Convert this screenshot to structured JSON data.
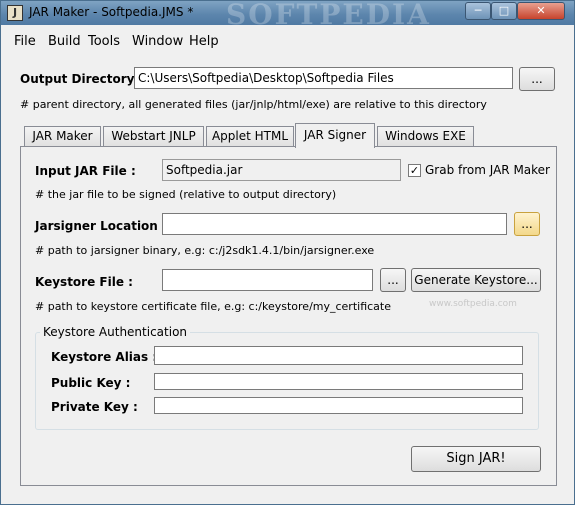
{
  "window": {
    "title": "JAR Maker - Softpedia.JMS *",
    "watermark": "SOFTPEDIA",
    "controls": {
      "minimize": "─",
      "maximize": "□",
      "close": "✕"
    }
  },
  "menu": [
    {
      "label": "File"
    },
    {
      "label": "Build"
    },
    {
      "label": "Tools"
    },
    {
      "label": "Window"
    },
    {
      "label": "Help"
    }
  ],
  "output": {
    "label": "Output Directory :",
    "value": "C:\\Users\\Softpedia\\Desktop\\Softpedia Files",
    "browse": "...",
    "hint": "# parent directory, all generated files (jar/jnlp/html/exe) are relative to this directory"
  },
  "tabs": [
    {
      "label": "JAR Maker"
    },
    {
      "label": "Webstart JNLP"
    },
    {
      "label": "Applet HTML"
    },
    {
      "label": "JAR Signer"
    },
    {
      "label": "Windows EXE"
    }
  ],
  "signer": {
    "input_jar": {
      "label": "Input JAR File :",
      "value": "Softpedia.jar",
      "checkbox_label": "Grab from JAR Maker",
      "checked": "✓",
      "hint": "# the jar file to be signed (relative to output directory)"
    },
    "jarsigner": {
      "label": "Jarsigner Location :",
      "value": "",
      "browse": "...",
      "hint": "# path to jarsigner binary, e.g: c:/j2sdk1.4.1/bin/jarsigner.exe"
    },
    "keystore": {
      "label": "Keystore File :",
      "value": "",
      "browse": "...",
      "generate": "Generate Keystore...",
      "hint": "# path to keystore certificate file, e.g: c:/keystore/my_certificate"
    },
    "auth": {
      "title": "Keystore Authentication",
      "alias_label": "Keystore Alias :",
      "public_key_label": "Public Key :",
      "private_key_label": "Private Key :"
    },
    "sign_button": "Sign JAR!"
  },
  "softpedia_watermark": "www.softpedia.com"
}
